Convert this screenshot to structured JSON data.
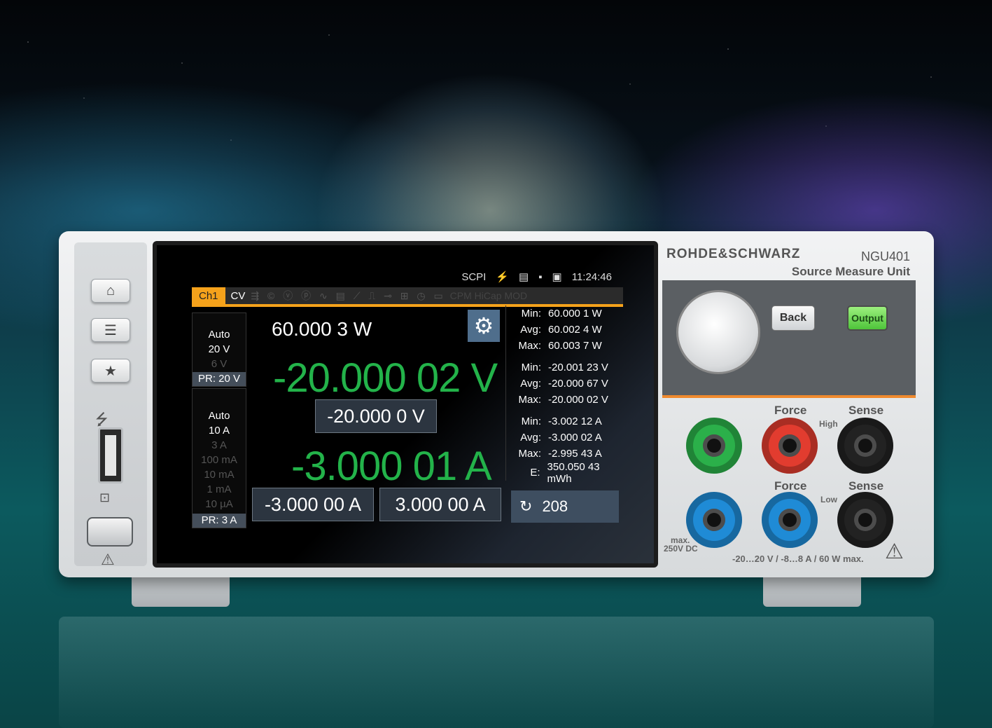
{
  "device": {
    "brand": "ROHDE&SCHWARZ",
    "model": "NGU401",
    "subtitle": "Source Measure Unit"
  },
  "icons": [
    "home-icon",
    "menu-icon",
    "star-icon",
    "usb-icon",
    "network-icon",
    "warning-icon",
    "settings-icon",
    "refresh-icon",
    "lightning-icon",
    "lan-icon"
  ],
  "screen": {
    "status": {
      "scpi": "SCPI",
      "time": "11:24:46"
    },
    "tabs": {
      "ch1": "Ch1",
      "mode": "CV",
      "faded": "CPM HiCap MOD"
    },
    "voltage_range": {
      "auto": "Auto",
      "r1": "20 V",
      "r2": "6 V",
      "pr": "PR: 20 V"
    },
    "current_range": {
      "auto": "Auto",
      "r1": "10 A",
      "r2": "3 A",
      "r3": "100 mA",
      "r4": "10 mA",
      "r5": "1 mA",
      "r6": "10 µA",
      "pr": "PR: 3 A"
    },
    "power": "60.000 3 W",
    "voltage": "-20.000 02 V",
    "voltage_set": "-20.000 0  V",
    "current": "-3.000 01 A",
    "current_set_low": "-3.000 00  A",
    "current_set_high": "3.000 00  A",
    "stats": {
      "power": {
        "min_k": "Min:",
        "min": "60.000 1 W",
        "avg_k": "Avg:",
        "avg": "60.002 4 W",
        "max_k": "Max:",
        "max": "60.003 7 W"
      },
      "voltage": {
        "min_k": "Min:",
        "min": "-20.001 23 V",
        "avg_k": "Avg:",
        "avg": "-20.000 67 V",
        "max_k": "Max:",
        "max": "-20.000 02 V"
      },
      "current": {
        "min_k": "Min:",
        "min": "-3.002 12 A",
        "avg_k": "Avg:",
        "avg": "-3.000 02 A",
        "max_k": "Max:",
        "max": "-2.995 43 A"
      },
      "energy_k": "E:",
      "energy": "350.050 43 mWh"
    },
    "counter": "208"
  },
  "controls": {
    "back": "Back",
    "output": "Output"
  },
  "terminals": {
    "force_high": "Force",
    "sense_high": "Sense",
    "high": "High",
    "force_low": "Force",
    "sense_low": "Sense",
    "low": "Low",
    "max_dc_1": "max.",
    "max_dc_2": "250V DC",
    "rating": "-20…20 V / -8…8 A / 60 W max."
  }
}
